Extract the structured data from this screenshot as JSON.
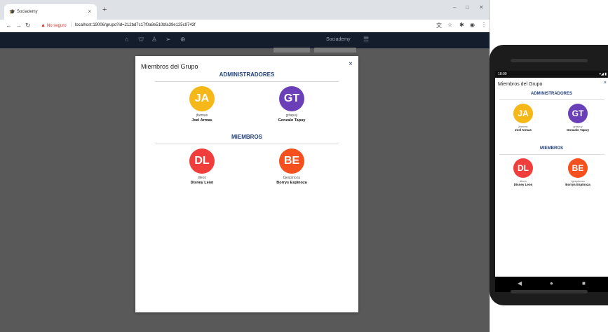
{
  "browser": {
    "tab_title": "Sociademy",
    "tab_close": "×",
    "new_tab": "+",
    "security_label": "No seguro",
    "url": "localhost:19006/grupo?id=212bd7c17f0a8e510bfa39e125c9743f",
    "window_controls": [
      "–",
      "□",
      "✕"
    ]
  },
  "app": {
    "brand": "Sociademy",
    "nav_icons": [
      "home-icon",
      "institution-icon",
      "person-icon",
      "send-icon",
      "globe-icon"
    ],
    "menu_icon": "menu-icon"
  },
  "modal": {
    "title": "Miembros del Grupo",
    "close": "×",
    "admins_heading": "ADMINISTRADORES",
    "members_heading": "MIEMBROS",
    "admins": [
      {
        "initials": "JA",
        "username": "jfarmas",
        "name": "Joel Armas",
        "color": "#f5b818"
      },
      {
        "initials": "GT",
        "username": "grtapuy",
        "name": "Gonzalo Tapuy",
        "color": "#6a3fb8"
      }
    ],
    "members": [
      {
        "initials": "DL",
        "username": "dleon",
        "name": "Disney Leon",
        "color": "#ef3e3b"
      },
      {
        "initials": "BE",
        "username": "bjespinoza",
        "name": "Borrys Espinoza",
        "color": "#f4511e"
      }
    ]
  },
  "phone": {
    "time": "18:00",
    "status_right": "▾◢ ▮",
    "title": "Miembros del Grupo",
    "close": "×",
    "nav_buttons": [
      "◀",
      "●",
      "■"
    ]
  },
  "colors": {
    "app_bar": "#141d2b",
    "heading": "#1f3f7a",
    "backdrop": "#595959"
  }
}
